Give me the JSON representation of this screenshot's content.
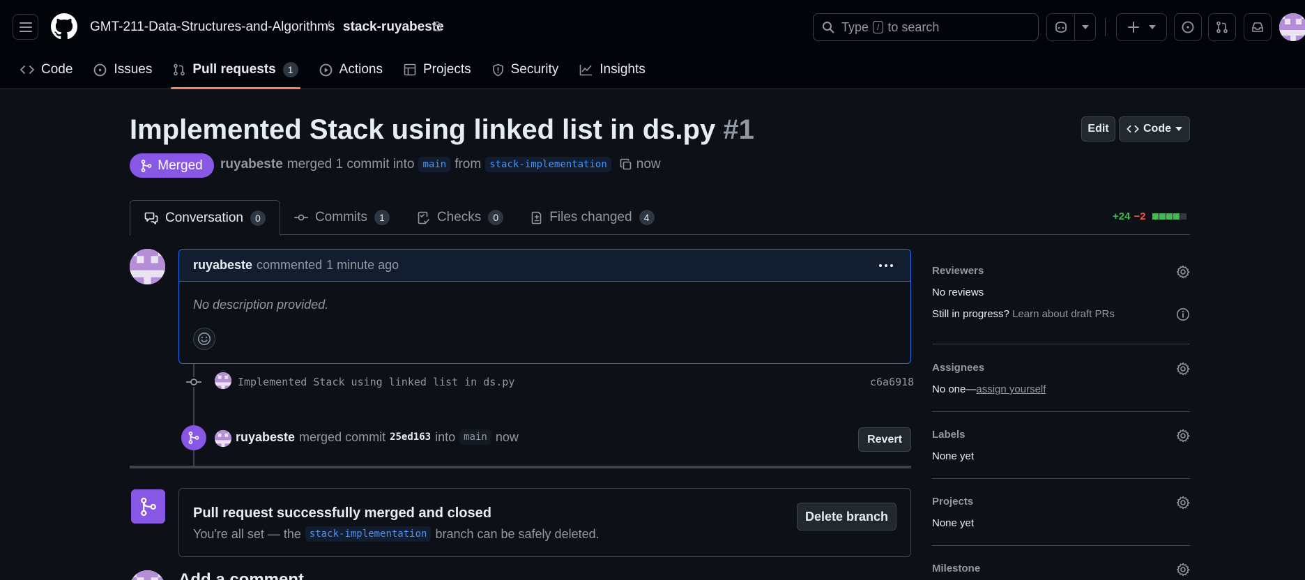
{
  "header": {
    "owner": "GMT-211-Data-Structures-and-Algorithms",
    "separator": "/",
    "repo": "stack-ruyabeste",
    "search_prefix": "Type",
    "search_key": "/",
    "search_suffix": "to search"
  },
  "repo_nav": [
    {
      "label": "Code",
      "icon": "code-icon"
    },
    {
      "label": "Issues",
      "icon": "issue-icon"
    },
    {
      "label": "Pull requests",
      "icon": "pull-request-icon",
      "count": "1",
      "active": true
    },
    {
      "label": "Actions",
      "icon": "play-icon"
    },
    {
      "label": "Projects",
      "icon": "table-icon"
    },
    {
      "label": "Security",
      "icon": "shield-icon"
    },
    {
      "label": "Insights",
      "icon": "graph-icon"
    }
  ],
  "pr": {
    "title": "Implemented Stack using linked list in ds.py",
    "number": "#1",
    "edit_label": "Edit",
    "code_label": "Code",
    "state": "Merged",
    "author": "ruyabeste",
    "merged_text": "merged 1 commit into",
    "base_branch": "main",
    "from_text": "from",
    "head_branch": "stack-implementation",
    "time": "now"
  },
  "tabs": [
    {
      "label": "Conversation",
      "count": "0",
      "icon": "comment-discussion-icon"
    },
    {
      "label": "Commits",
      "count": "1",
      "icon": "commit-icon"
    },
    {
      "label": "Checks",
      "count": "0",
      "icon": "checklist-icon"
    },
    {
      "label": "Files changed",
      "count": "4",
      "icon": "file-diff-icon"
    }
  ],
  "diffstat": {
    "additions": "+24",
    "deletions": "−2",
    "blocks_green": 4,
    "blocks_total": 5
  },
  "comment": {
    "author": "ruyabeste",
    "action": "commented",
    "time": "1 minute ago",
    "body": "No description provided."
  },
  "commit": {
    "message": "Implemented Stack using linked list in ds.py",
    "sha": "c6a6918"
  },
  "merge_event": {
    "author": "ruyabeste",
    "action": "merged commit",
    "sha": "25ed163",
    "into": "into",
    "branch": "main",
    "time": "now",
    "revert_label": "Revert"
  },
  "merged_box": {
    "title": "Pull request successfully merged and closed",
    "sub_prefix": "You're all set — the",
    "branch": "stack-implementation",
    "sub_suffix": "branch can be safely deleted.",
    "delete_label": "Delete branch"
  },
  "add_comment": "Add a comment",
  "sidebar": {
    "reviewers": {
      "title": "Reviewers",
      "value": "No reviews",
      "draft_q": "Still in progress?",
      "draft_link": "Learn about draft PRs"
    },
    "assignees": {
      "title": "Assignees",
      "value": "No one—",
      "link": "assign yourself"
    },
    "labels": {
      "title": "Labels",
      "value": "None yet"
    },
    "projects": {
      "title": "Projects",
      "value": "None yet"
    },
    "milestone": {
      "title": "Milestone"
    }
  },
  "colors": {
    "merged": "#8957e5",
    "accent_underline": "#f78166",
    "link": "#4493f8",
    "add": "#3fb950",
    "del": "#f85149"
  }
}
